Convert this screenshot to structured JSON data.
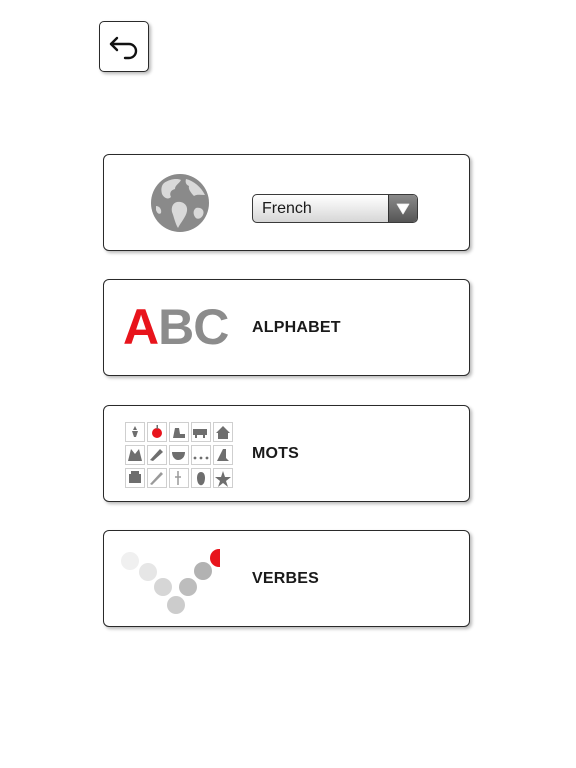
{
  "colors": {
    "accent_red": "#e8141c",
    "icon_gray": "#8c8c8c",
    "border": "#2a2a2a",
    "text": "#1a1a1a"
  },
  "back_button": {
    "icon": "back-arrow-icon"
  },
  "language": {
    "icon": "globe-icon",
    "selected": "French"
  },
  "menu": {
    "alphabet": {
      "icon_letters": [
        "A",
        "BC"
      ],
      "label": "ALPHABET"
    },
    "mots": {
      "icon": "word-pictures-grid-icon",
      "label": "MOTS"
    },
    "verbes": {
      "icon": "verb-dots-icon",
      "label": "VERBES"
    }
  }
}
